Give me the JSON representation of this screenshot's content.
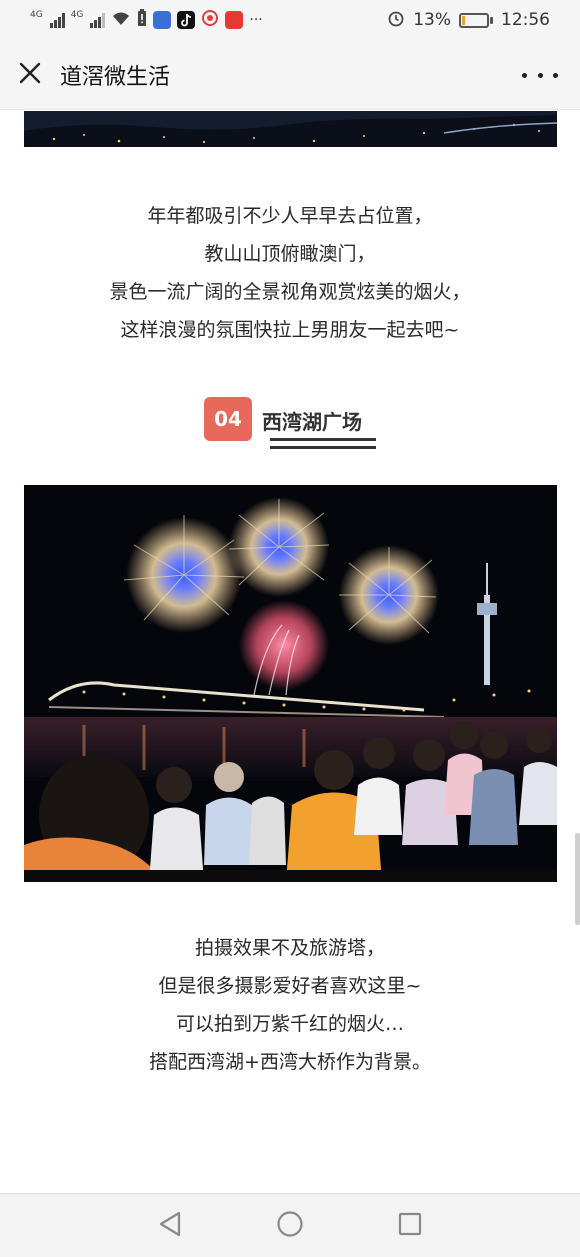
{
  "status_bar": {
    "net1": "4G",
    "net2": "4G",
    "more": "···",
    "battery_pct": "13%",
    "battery_level": 0.13,
    "time": "12:56",
    "icons": [
      "signal-icon",
      "wifi-icon",
      "battery-alert-icon",
      "app-icon",
      "tiktok-icon",
      "weibo-icon",
      "app-icon",
      "alarm-icon",
      "battery-icon"
    ]
  },
  "header": {
    "title": "道滘微生活",
    "close_icon": "close-icon",
    "more_icon": "more-icon"
  },
  "article": {
    "para1": [
      "年年都吸引不少人早早去占位置，",
      "教山山顶俯瞰澳门，",
      "景色一流广阔的全景视角观赏炫美的烟火，",
      "这样浪漫的氛围快拉上男朋友一起去吧~"
    ],
    "section": {
      "number": "04",
      "title": "西湾湖广场"
    },
    "para2": [
      "拍摄效果不及旅游塔，",
      "但是很多摄影爱好者喜欢这里~",
      "可以拍到万紫千红的烟火…",
      "搭配西湾湖+西湾大桥作为背景。"
    ]
  },
  "colors": {
    "accent": "#e8685c",
    "bar_bg": "#f5f5f5",
    "battery_fill": "#f0a030"
  },
  "nav": {
    "icons": [
      "back-icon",
      "home-icon",
      "recents-icon"
    ]
  }
}
